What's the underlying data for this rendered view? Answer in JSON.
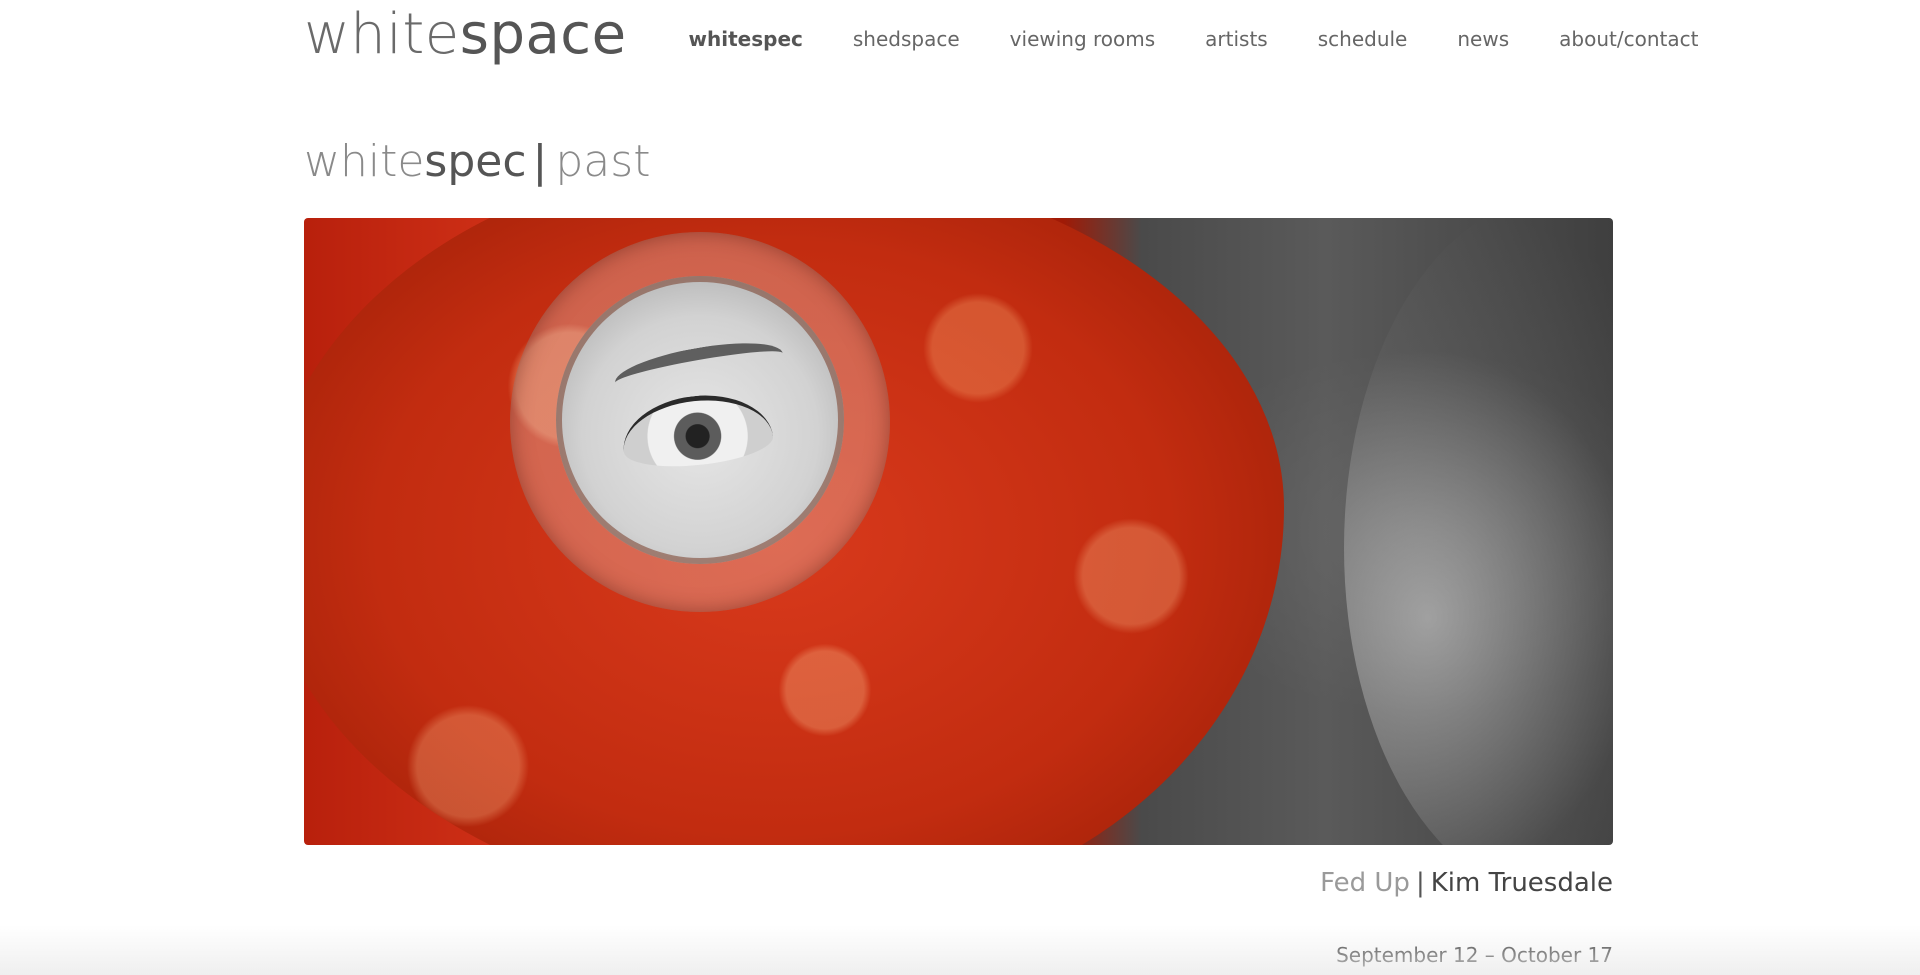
{
  "header": {
    "logo_light": "white",
    "logo_bold": "space",
    "nav": [
      {
        "label": "whitespec",
        "active": true
      },
      {
        "label": "shedspace",
        "active": false
      },
      {
        "label": "viewing rooms",
        "active": false
      },
      {
        "label": "artists",
        "active": false
      },
      {
        "label": "schedule",
        "active": false
      },
      {
        "label": "news",
        "active": false
      },
      {
        "label": "about/contact",
        "active": false
      }
    ]
  },
  "section": {
    "title_light": "white",
    "title_bold": "spec",
    "separator": "|",
    "subtitle": "past"
  },
  "exhibition": {
    "title": "Fed Up",
    "separator": "|",
    "artist": "Kim Truesdale",
    "dates": "September 12 – October 17"
  }
}
